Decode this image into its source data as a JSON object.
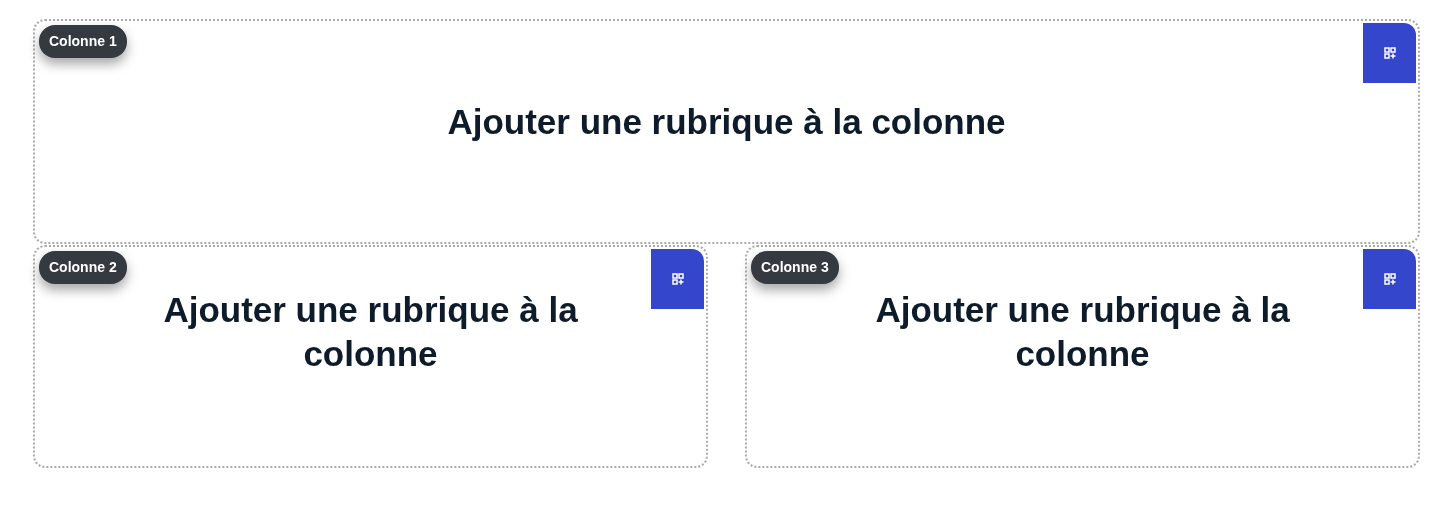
{
  "rows": [
    {
      "columns": [
        {
          "badge": "Colonne 1",
          "title": "Ajouter une rubrique à la colonne"
        }
      ]
    },
    {
      "columns": [
        {
          "badge": "Colonne 2",
          "title": "Ajouter une rubrique à la colonne"
        },
        {
          "badge": "Colonne 3",
          "title": "Ajouter une rubrique à la colonne"
        }
      ]
    }
  ]
}
